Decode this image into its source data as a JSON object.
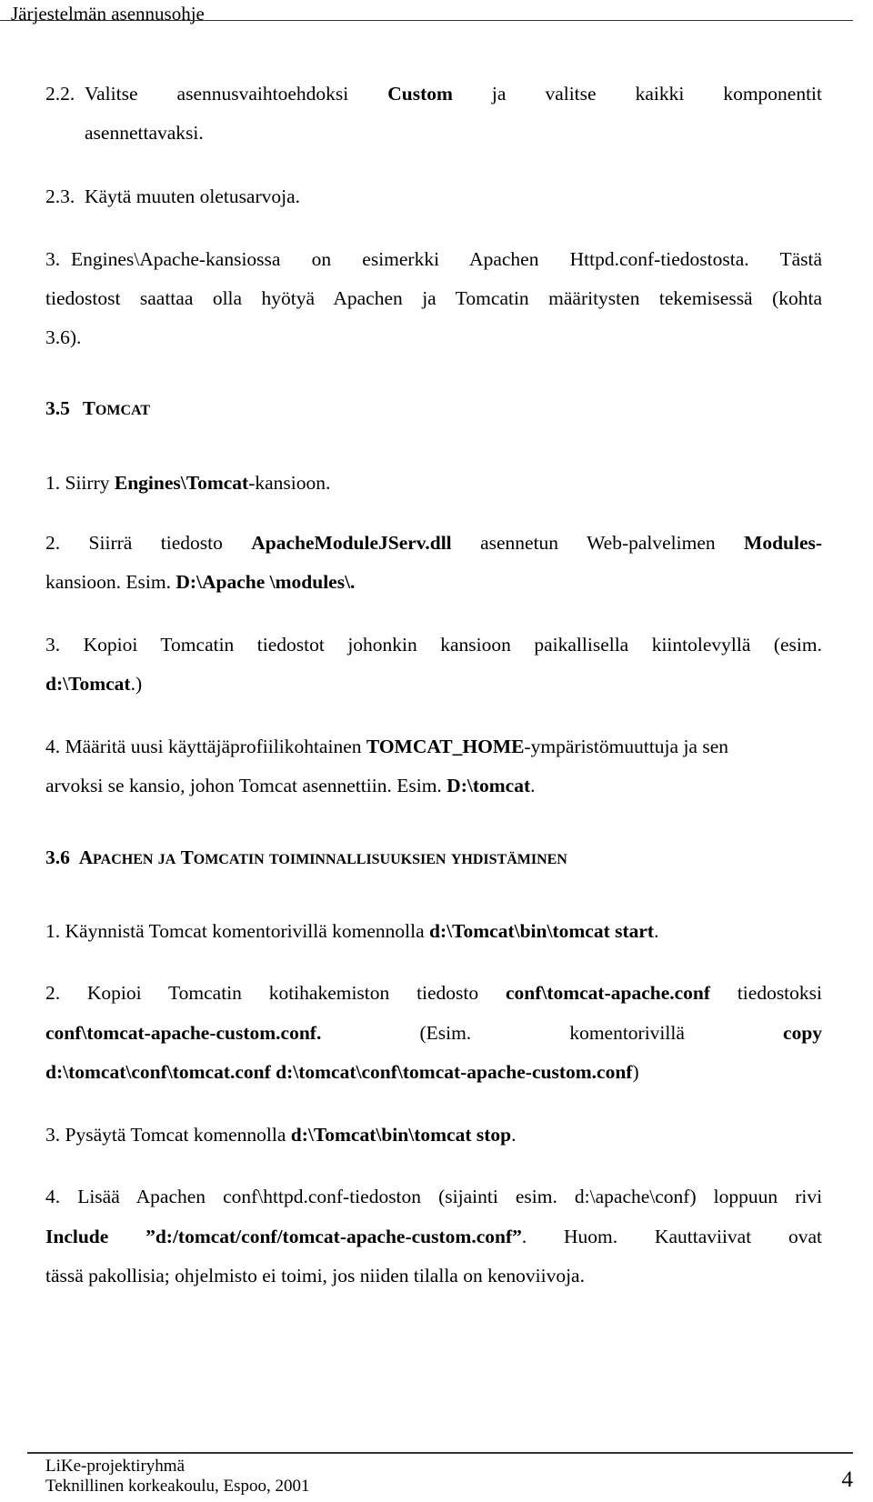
{
  "header": {
    "title": "Järjestelmän asennusohje"
  },
  "section_top": {
    "item_2_2": {
      "num": "2.2.",
      "parts": [
        "Valitse",
        "asennusvaihtoehdoksi",
        "Custom",
        "ja",
        "valitse",
        "kaikki",
        "komponentit"
      ],
      "cont": "asennettavaksi."
    },
    "item_2_3": {
      "num": "2.3.",
      "text": "Käytä muuten oletusarvoja."
    },
    "item_3": {
      "num": "3.",
      "line1_parts": [
        "Engines\\Apache-kansiossa",
        "on",
        "esimerkki",
        "Apachen",
        "Httpd.conf-tiedostosta.",
        "Tästä"
      ],
      "line2_parts": [
        "tiedostost",
        "saattaa",
        "olla",
        "hyötyä",
        "Apachen",
        "ja",
        "Tomcatin",
        "määritysten",
        "tekemisessä",
        "(kohta"
      ],
      "line3": "3.6)."
    }
  },
  "section_3_5": {
    "number": "3.5",
    "title_first": "T",
    "title_rest": "OMCAT",
    "items": [
      {
        "num": "1.",
        "pre": "Siirry ",
        "bold": "Engines\\Tomcat",
        "post": "-kansioon."
      },
      {
        "num": "2.",
        "line1_parts": [
          "Siirrä",
          "tiedosto",
          "ApacheModuleJServ.dll",
          "asennetun",
          "Web-palvelimen",
          "Modules-"
        ],
        "line2_pre": "kansioon. Esim. ",
        "line2_bold": "D:\\Apache \\modules\\."
      },
      {
        "num": "3.",
        "line1_parts": [
          "Kopioi",
          "Tomcatin",
          "tiedostot",
          "johonkin",
          "kansioon",
          "paikallisella",
          "kiintolevyllä",
          "(esim."
        ],
        "line2_bold": "d:\\Tomcat",
        "line2_post": ".)"
      },
      {
        "num": "4.",
        "line1_pre": "Määritä uusi käyttäjäprofiilikohtainen ",
        "line1_bold": "TOMCAT_HOME",
        "line1_post": "-ympäristömuuttuja ja sen",
        "line2_pre": "arvoksi se kansio, johon Tomcat asennettiin. Esim. ",
        "line2_bold": "D:\\tomcat",
        "line2_post": "."
      }
    ]
  },
  "section_3_6": {
    "number": "3.6",
    "title_words": [
      {
        "first": "A",
        "rest": "PACHEN"
      },
      {
        "first": "",
        "rest": "JA"
      },
      {
        "first": "T",
        "rest": "OMCATIN"
      },
      {
        "first": "",
        "rest": "TOIMINNALLISUUKSIEN"
      },
      {
        "first": "",
        "rest": "YHDISTÄMINEN"
      }
    ],
    "items": [
      {
        "num": "1.",
        "pre": "Käynnistä Tomcat komentorivillä komennolla ",
        "bold": "d:\\Tomcat\\bin\\tomcat start",
        "post": "."
      },
      {
        "num": "2.",
        "line1_parts": [
          "Kopioi",
          "Tomcatin",
          "kotihakemiston",
          "tiedosto",
          "conf\\tomcat-apache.conf",
          "tiedostoksi"
        ],
        "line2_parts": [
          "conf\\tomcat-apache-custom.conf.",
          "(Esim.",
          "komentorivillä",
          "copy"
        ],
        "line3_bold": "d:\\tomcat\\conf\\tomcat.conf d:\\tomcat\\conf\\tomcat-apache-custom.conf",
        "line3_post": ")"
      },
      {
        "num": "3.",
        "pre": "Pysäytä Tomcat komennolla ",
        "bold": "d:\\Tomcat\\bin\\tomcat stop",
        "post": "."
      },
      {
        "num": "4.",
        "line1_parts": [
          "Lisää",
          "Apachen",
          "conf\\httpd.conf-tiedoston",
          "(sijainti",
          "esim.",
          "d:\\apache\\conf)",
          "loppuun",
          "rivi"
        ],
        "line2_bold": "Include ”d:/tomcat/conf/tomcat-apache-custom.conf”",
        "line2_post_parts": [
          ".",
          "Huom.",
          "Kauttaviivat",
          "ovat"
        ],
        "line3": "tässä pakollisia; ohjelmisto ei toimi, jos niiden tilalla on kenoviivoja."
      }
    ]
  },
  "footer": {
    "line1": "LiKe-projektiryhmä",
    "line2": "Teknillinen korkeakoulu, Espoo, 2001",
    "page_number": "4"
  }
}
